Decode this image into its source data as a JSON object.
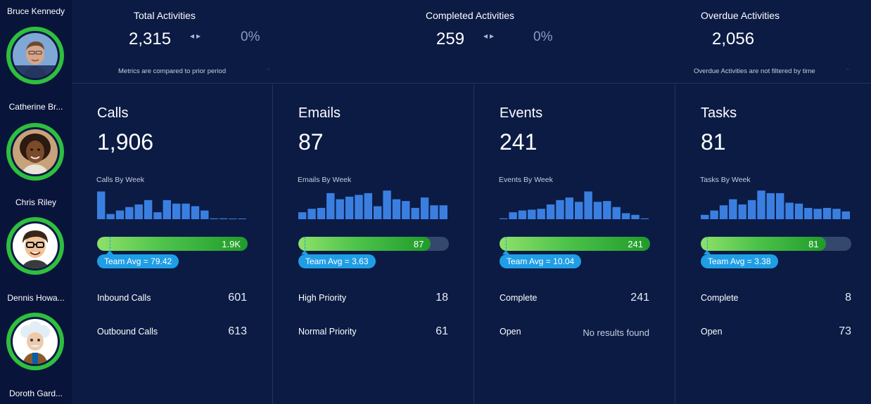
{
  "sidebar": {
    "users": [
      {
        "name": "Bruce Kennedy",
        "avatar_icon": "man-photo-avatar"
      },
      {
        "name": "Catherine Br...",
        "avatar_icon": "woman-photo-avatar"
      },
      {
        "name": "Chris Riley",
        "avatar_icon": "man-glasses-avatar"
      },
      {
        "name": "Dennis Howa...",
        "avatar_icon": "einstein-mascot-avatar"
      },
      {
        "name": "Doroth Gard..."
      }
    ]
  },
  "header": {
    "total": {
      "title": "Total Activities",
      "value": "2,315",
      "arrows": "◂▸",
      "pct": "0%"
    },
    "completed": {
      "title": "Completed Activities",
      "value": "259",
      "arrows": "◂▸",
      "pct": "0%"
    },
    "overdue": {
      "title": "Overdue Activities",
      "value": "2,056"
    },
    "note_left": "Metrics are compared to prior period",
    "note_right": "Overdue Activities are not filtered by time",
    "note_tick": "\""
  },
  "panels": [
    {
      "title": "Calls",
      "count": "1,906",
      "chart_label": "Calls By Week",
      "fill_label": "1.9K",
      "avg_label": "Team Avg = 79.42",
      "rows": [
        {
          "label": "Inbound Calls",
          "value": "601"
        },
        {
          "label": "Outbound Calls",
          "value": "613"
        }
      ]
    },
    {
      "title": "Emails",
      "count": "87",
      "chart_label": "Emails By Week",
      "fill_label": "87",
      "avg_label": "Team Avg = 3.63",
      "rows": [
        {
          "label": "High Priority",
          "value": "18"
        },
        {
          "label": "Normal Priority",
          "value": "61"
        }
      ]
    },
    {
      "title": "Events",
      "count": "241",
      "chart_label": "Events By Week",
      "fill_label": "241",
      "avg_label": "Team Avg = 10.04",
      "rows": [
        {
          "label": "Complete",
          "value": "241"
        },
        {
          "label": "Open",
          "value": "No results found"
        }
      ]
    },
    {
      "title": "Tasks",
      "count": "81",
      "chart_label": "Tasks By Week",
      "fill_label": "81",
      "avg_label": "Team Avg = 3.38",
      "rows": [
        {
          "label": "Complete",
          "value": "8"
        },
        {
          "label": "Open",
          "value": "73"
        }
      ]
    }
  ],
  "colors": {
    "background": "#0b1b44",
    "sidebar": "#08143a",
    "ring": "#2fbf3e",
    "bar_chart": "#3a7fe0",
    "progress_fill": "#4cc24a",
    "progress_track": "#34486e",
    "team_avg": "#1f9ee6"
  },
  "chart_data": [
    {
      "type": "bar",
      "title": "Calls By Week",
      "values": [
        32,
        6,
        10,
        14,
        17,
        22,
        8,
        22,
        18,
        18,
        15,
        10,
        1,
        1,
        0.5,
        0.5
      ]
    },
    {
      "type": "bar",
      "title": "Emails By Week",
      "values": [
        8,
        12,
        13,
        30,
        23,
        26,
        28,
        30,
        15,
        33,
        23,
        21,
        13,
        25,
        16,
        16
      ]
    },
    {
      "type": "bar",
      "title": "Events By Week",
      "values": [
        1,
        8,
        10,
        11,
        12,
        17,
        22,
        25,
        20,
        32,
        20,
        21,
        14,
        7,
        5,
        1
      ]
    },
    {
      "type": "bar",
      "title": "Tasks By Week",
      "values": [
        5,
        10,
        16,
        23,
        17,
        22,
        33,
        30,
        30,
        19,
        18,
        13,
        12,
        13,
        12,
        9
      ]
    }
  ],
  "progress": [
    {
      "panel": "Calls",
      "fill_fraction": 1.0,
      "avg_fraction": 0.085
    },
    {
      "panel": "Emails",
      "fill_fraction": 0.88,
      "avg_fraction": 0.042
    },
    {
      "panel": "Events",
      "fill_fraction": 1.0,
      "avg_fraction": 0.042
    },
    {
      "panel": "Tasks",
      "fill_fraction": 0.83,
      "avg_fraction": 0.042
    }
  ]
}
